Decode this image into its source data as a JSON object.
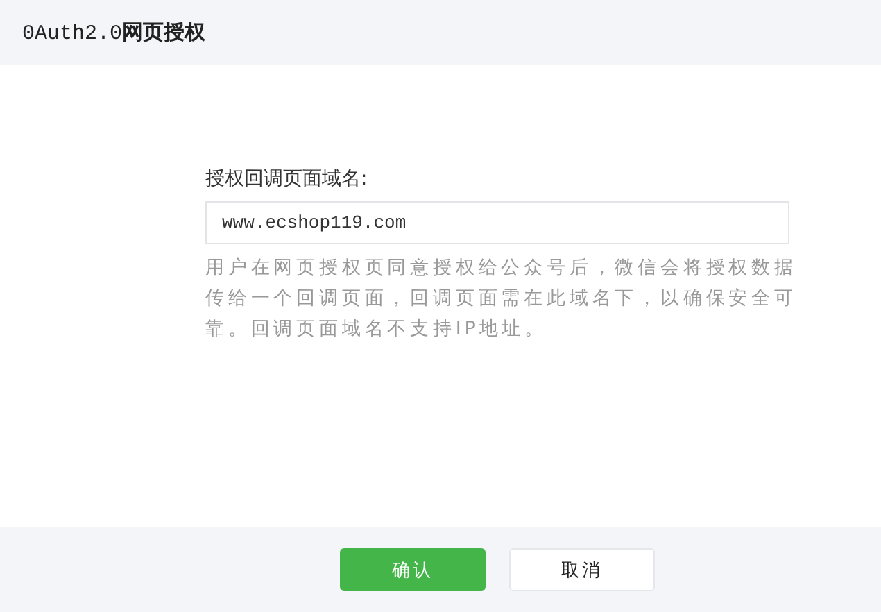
{
  "window": {
    "title": "0Auth2.0**网页授权**"
  },
  "form": {
    "label": "授权回调页面域名:",
    "field": {
      "value": "www.ecshop119.com"
    },
    "help": "用户在网页授权页同意授权给公众号后，微信会将授权数据传给一个回调页面，回调页面需在此域名下，以确保安全可靠。回调页面域名不支持IP地址。"
  },
  "buttons": [
    {
      "label": "确认",
      "kind": "primary"
    },
    {
      "label": "取消",
      "kind": "default"
    }
  ]
}
